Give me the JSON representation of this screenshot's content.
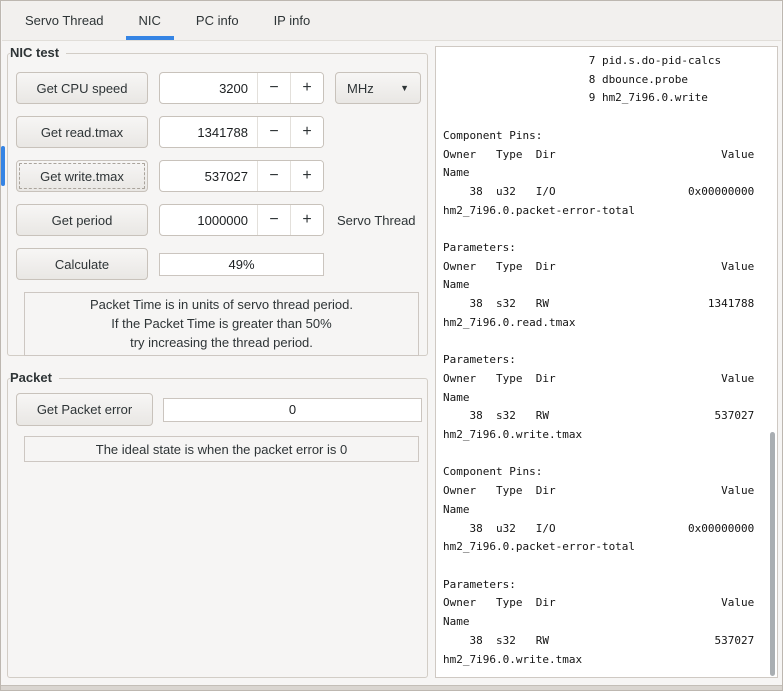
{
  "colors": {
    "accent": "#3584e4"
  },
  "icons": {
    "minus": "−",
    "plus": "+",
    "dropdown_arrow": "▼"
  },
  "tabs": [
    {
      "label": "Servo Thread",
      "active": false
    },
    {
      "label": "NIC",
      "active": true
    },
    {
      "label": "PC info",
      "active": false
    },
    {
      "label": "IP info",
      "active": false
    }
  ],
  "nic_test": {
    "title": "NIC test",
    "rows": [
      {
        "button": "Get CPU speed",
        "value": "3200",
        "unit": "MHz"
      },
      {
        "button": "Get read.tmax",
        "value": "1341788"
      },
      {
        "button": "Get write.tmax",
        "value": "537027"
      },
      {
        "button": "Get period",
        "value": "1000000",
        "suffix_label": "Servo Thread"
      }
    ],
    "calculate_button": "Calculate",
    "packet_time_percent": "49%",
    "note_lines": [
      "Packet Time is in units of servo thread period.",
      "If the Packet Time is greater than 50%",
      "try increasing the thread period."
    ]
  },
  "packet": {
    "title": "Packet",
    "button": "Get Packet error",
    "error_value": "0",
    "note": "The ideal state is when the packet error is 0"
  },
  "output": {
    "lines": [
      "                      7 pid.s.do-pid-calcs",
      "                      8 dbounce.probe",
      "                      9 hm2_7i96.0.write",
      "",
      "Component Pins:",
      "Owner   Type  Dir                         Value",
      "Name",
      "    38  u32   I/O                    0x00000000",
      "hm2_7i96.0.packet-error-total",
      "",
      "Parameters:",
      "Owner   Type  Dir                         Value",
      "Name",
      "    38  s32   RW                        1341788",
      "hm2_7i96.0.read.tmax",
      "",
      "Parameters:",
      "Owner   Type  Dir                         Value",
      "Name",
      "    38  s32   RW                         537027",
      "hm2_7i96.0.write.tmax",
      "",
      "Component Pins:",
      "Owner   Type  Dir                         Value",
      "Name",
      "    38  u32   I/O                    0x00000000",
      "hm2_7i96.0.packet-error-total",
      "",
      "Parameters:",
      "Owner   Type  Dir                         Value",
      "Name",
      "    38  s32   RW                         537027",
      "hm2_7i96.0.write.tmax"
    ]
  }
}
